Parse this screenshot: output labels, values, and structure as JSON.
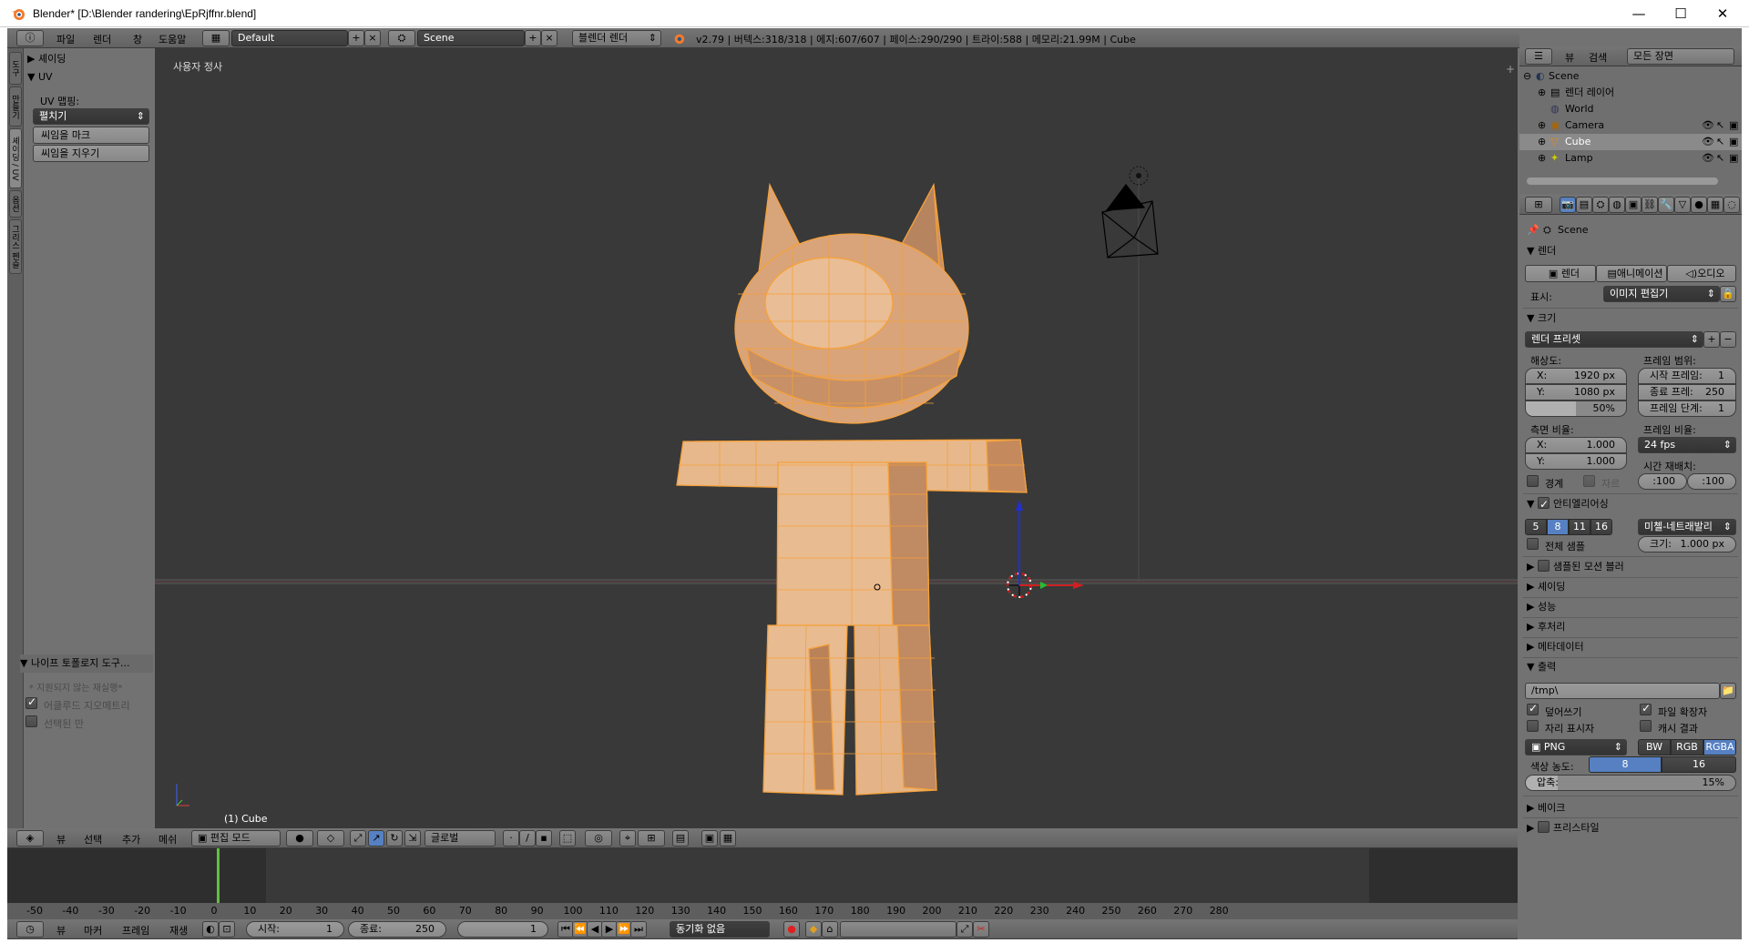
{
  "window": {
    "title": "Blender* [D:\\Blender randering\\EpRjffnr.blend]",
    "controls": {
      "minimize": "—",
      "maximize": "☐",
      "close": "✕"
    }
  },
  "info_header": {
    "menus": [
      "파일",
      "렌더",
      "창",
      "도움말"
    ],
    "layout": "Default",
    "scene": "Scene",
    "engine": "블렌더 렌더",
    "stats": "v2.79 | 버텍스:318/318 | 에지:607/607 | 페이스:290/290 | 트라이:588 | 메모리:21.99M | Cube"
  },
  "toolshelf": {
    "tabs": [
      "도구",
      "만들기",
      "셰이딩 / UV",
      "옵션",
      "그리스 펜슬"
    ],
    "shading_panel": "셰이딩",
    "uv_panel": "UV",
    "uv_mapping_label": "UV 맵핑:",
    "unwrap": "펼치기",
    "mark_seam": "씨임을 마크",
    "clear_seam": "씨임을 지우기",
    "knife_panel": "나이프 토폴로지 도구...",
    "unsupported": "* 지원되지 않는 재실행*",
    "occlude_geometry": "어클루드 지오메트리",
    "only_selected": "선택된 만"
  },
  "viewport": {
    "view_name": "사용자 정사",
    "object_label": "(1) Cube",
    "header": {
      "menus": [
        "뷰",
        "선택",
        "추가",
        "메쉬"
      ],
      "mode": "편집 모드",
      "orientation": "글로벌"
    }
  },
  "timeline": {
    "ruler": [
      "-50",
      "-40",
      "-30",
      "-20",
      "-10",
      "0",
      "10",
      "20",
      "30",
      "40",
      "50",
      "60",
      "70",
      "80",
      "90",
      "100",
      "110",
      "120",
      "130",
      "140",
      "150",
      "160",
      "170",
      "180",
      "190",
      "200",
      "210",
      "220",
      "230",
      "240",
      "250",
      "260",
      "270",
      "280"
    ],
    "current_frame_value": 1,
    "menus": [
      "뷰",
      "마커",
      "프레임",
      "재생"
    ],
    "start_label": "시작:",
    "start": "1",
    "end_label": "종료:",
    "end": "250",
    "current": "1",
    "sync": "동기화 없음"
  },
  "outliner": {
    "view_menu": "뷰",
    "search_menu": "검색",
    "display": "모든 장면",
    "items": [
      {
        "name": "Scene",
        "icon": "scene-icon"
      },
      {
        "name": "렌더 레이어",
        "icon": "render-layers-icon"
      },
      {
        "name": "World",
        "icon": "world-icon"
      },
      {
        "name": "Camera",
        "icon": "camera-icon"
      },
      {
        "name": "Cube",
        "icon": "mesh-icon"
      },
      {
        "name": "Lamp",
        "icon": "lamp-icon"
      }
    ]
  },
  "properties": {
    "context": "Scene",
    "render_panel": "렌더",
    "render_btn": "렌더",
    "animation_btn": "애니메이션",
    "audio_btn": "오디오",
    "display_label": "표시:",
    "display_value": "이미지 편집기",
    "dimensions_panel": "크기",
    "render_presets": "렌더 프리셋",
    "resolution_label": "해상도:",
    "res_x_label": "X:",
    "res_x": "1920 px",
    "res_y_label": "Y:",
    "res_y": "1080 px",
    "res_pct": "50%",
    "resolution_percent_value": 50,
    "frame_range_label": "프레임 범위:",
    "frame_start_label": "시작 프레임:",
    "frame_start": "1",
    "frame_end_label": "종료 프레:",
    "frame_end": "250",
    "frame_step_label": "프레임 단계:",
    "frame_step": "1",
    "aspect_label": "측면 비율:",
    "aspect_x": "1.000",
    "aspect_y": "1.000",
    "frame_rate_label": "프레임 비율:",
    "fps": "24 fps",
    "time_remap_label": "시간 재배치:",
    "remap_old": ":100",
    "remap_new": ":100",
    "border": "경계",
    "crop": "자르",
    "aa_panel": "안티엘리어싱",
    "aa_samples": [
      "5",
      "8",
      "11",
      "16"
    ],
    "aa_selected": "8",
    "aa_filter": "미첼-네트래발리",
    "full_sample": "전체 샘플",
    "size_label": "크기:",
    "size_value": "1.000 px",
    "collapsed_panels": [
      "샘플된 모션 블러",
      "셰이딩",
      "성능",
      "후처리",
      "메타데이터"
    ],
    "output_panel": "출력",
    "output_path": "/tmp\\",
    "overwrite": "덮어쓰기",
    "file_extensions": "파일 확장자",
    "placeholders": "자리 표시자",
    "cache_result": "캐시 결과",
    "format": "PNG",
    "color_modes": [
      "BW",
      "RGB",
      "RGBA"
    ],
    "color_mode_selected": "RGBA",
    "color_depth_label": "색상 농도:",
    "color_depths": [
      "8",
      "16"
    ],
    "compression_label": "압축:",
    "compression": "15%",
    "compression_value": 15,
    "bake_panel": "베이크",
    "freestyle_panel": "프리스타일"
  },
  "colors": {
    "selected_edge": "#f5a13a",
    "face": "#e9b98a",
    "viewport_bg": "#393939",
    "panel_bg": "#727272",
    "active_blue": "#5680c2",
    "frame_marker": "#60c040"
  }
}
